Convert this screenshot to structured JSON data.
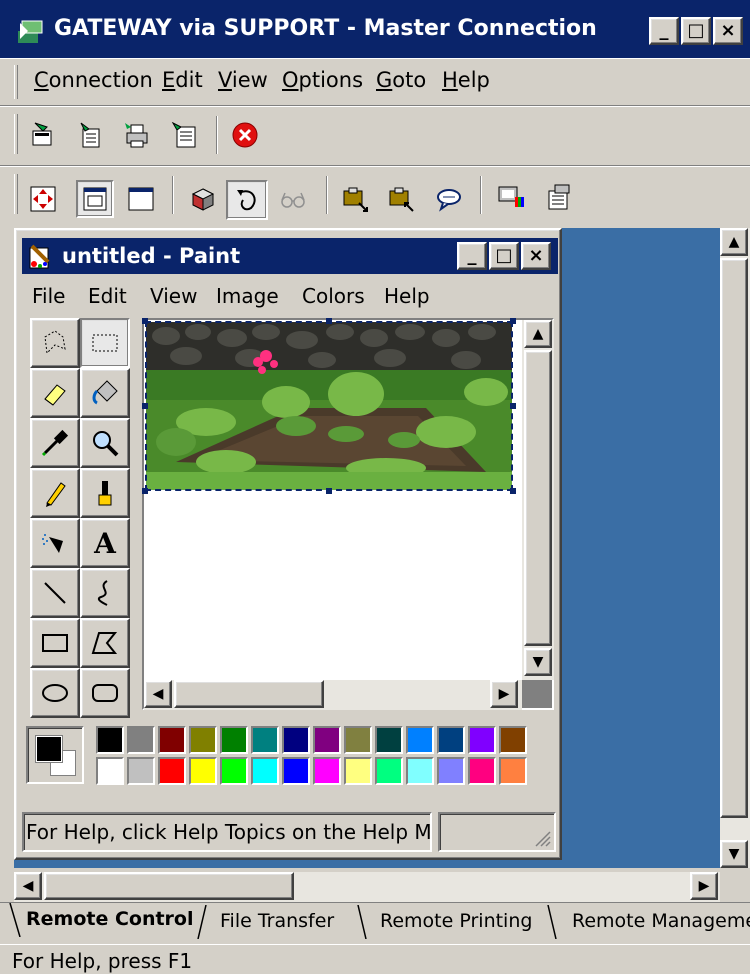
{
  "window": {
    "title": "GATEWAY via SUPPORT - Master Connection",
    "minimize": "_",
    "maximize": "□",
    "close": "×"
  },
  "menu": [
    {
      "pre": "",
      "key": "C",
      "post": "onnection"
    },
    {
      "pre": "",
      "key": "E",
      "post": "dit"
    },
    {
      "pre": "",
      "key": "V",
      "post": "iew"
    },
    {
      "pre": "",
      "key": "O",
      "post": "ptions"
    },
    {
      "pre": "",
      "key": "G",
      "post": "oto"
    },
    {
      "pre": "",
      "key": "H",
      "post": "elp"
    }
  ],
  "toolbar1": {
    "icons": [
      "connect-icon",
      "disconnect-icon",
      "print-icon",
      "properties-icon",
      "stop-icon"
    ]
  },
  "toolbar2": {
    "icons": [
      "full-screen-icon",
      "scaled-view-icon",
      "window-view-icon",
      "cube-icon",
      "rotate-icon",
      "glasses-icon",
      "clipboard-send-icon",
      "clipboard-get-icon",
      "chat-icon",
      "remote-computer-icon",
      "remote-properties-icon"
    ]
  },
  "paint": {
    "title": "untitled - Paint",
    "menu": [
      "File",
      "Edit",
      "View",
      "Image",
      "Colors",
      "Help"
    ],
    "tools": [
      "free-form-select-icon",
      "select-icon",
      "eraser-icon",
      "fill-icon",
      "color-picker-icon",
      "magnifier-icon",
      "pencil-icon",
      "brush-icon",
      "airbrush-icon",
      "text-icon",
      "line-icon",
      "curve-icon",
      "rectangle-icon",
      "polygon-icon",
      "ellipse-icon",
      "rounded-rectangle-icon"
    ],
    "text_tool_glyph": "A",
    "selected_tool": "select-icon",
    "foreground_color": "#000000",
    "background_color": "#ffffff",
    "palette_top": [
      "#000000",
      "#808080",
      "#800000",
      "#808000",
      "#008000",
      "#008080",
      "#000080",
      "#800080",
      "#808040",
      "#004040",
      "#0080ff",
      "#004080",
      "#8000ff",
      "#804000"
    ],
    "palette_bottom": [
      "#ffffff",
      "#c0c0c0",
      "#ff0000",
      "#ffff00",
      "#00ff00",
      "#00ffff",
      "#0000ff",
      "#ff00ff",
      "#ffff80",
      "#00ff80",
      "#80ffff",
      "#8080ff",
      "#ff0080",
      "#ff8040"
    ],
    "status": "For Help, click Help Topics on the Help Menu."
  },
  "tabs": [
    {
      "label": "Remote Control",
      "active": true
    },
    {
      "label": "File Transfer",
      "active": false
    },
    {
      "label": "Remote Printing",
      "active": false
    },
    {
      "label": "Remote Management",
      "active": false
    }
  ],
  "status_bar": "For Help, press F1"
}
